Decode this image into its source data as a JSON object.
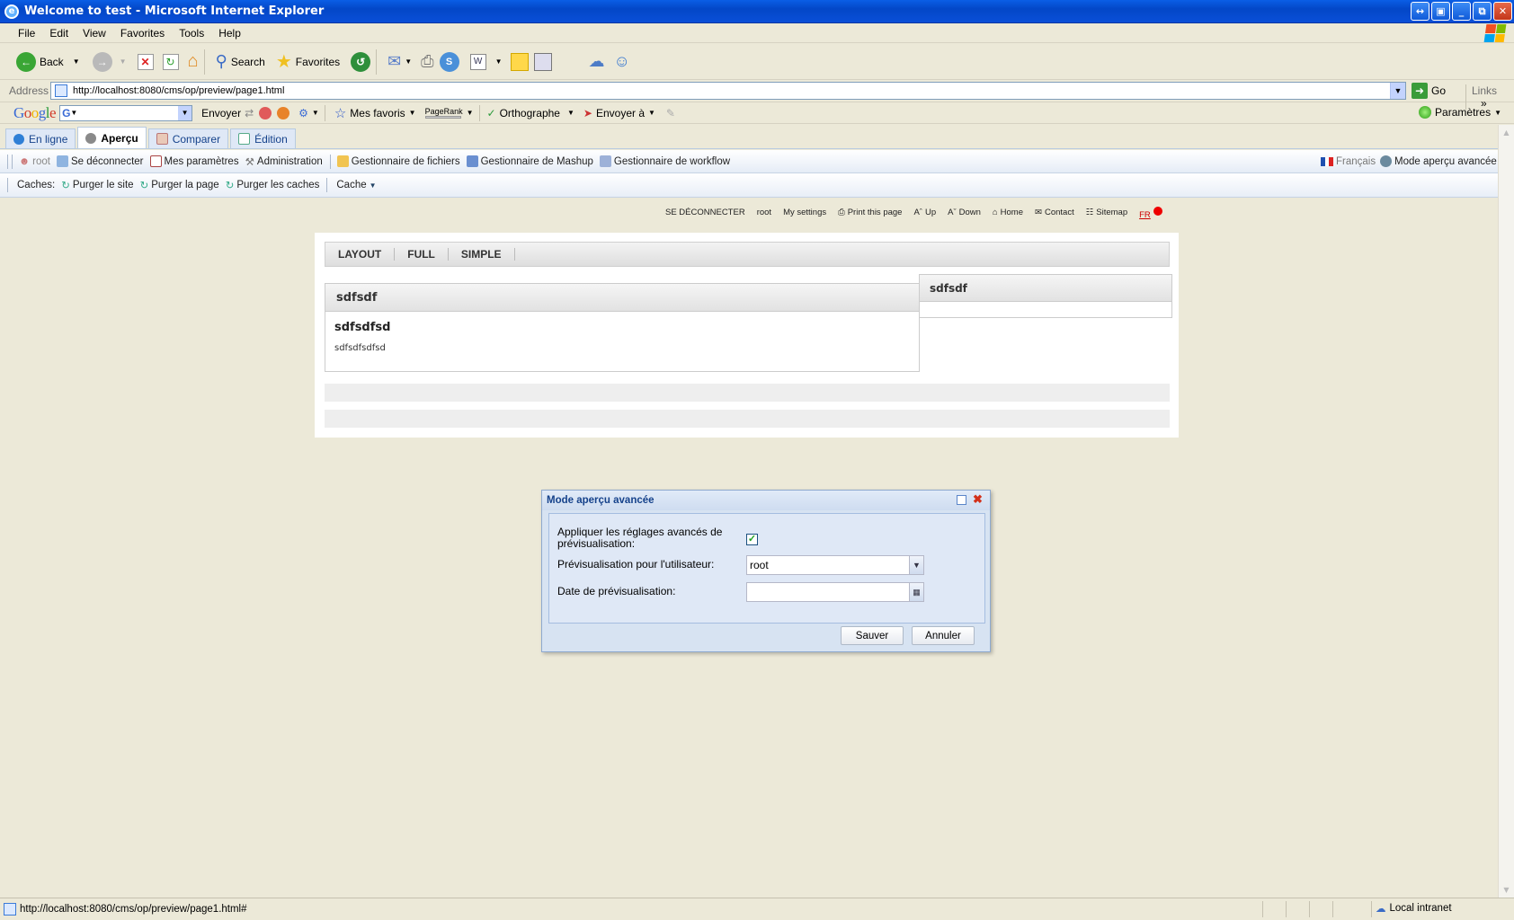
{
  "window": {
    "title": "Welcome to test - Microsoft Internet Explorer"
  },
  "menu": [
    "File",
    "Edit",
    "View",
    "Favorites",
    "Tools",
    "Help"
  ],
  "toolbar": {
    "back": "Back",
    "search": "Search",
    "favorites": "Favorites"
  },
  "address": {
    "label": "Address",
    "url": "http://localhost:8080/cms/op/preview/page1.html",
    "go": "Go",
    "links": "Links"
  },
  "google": {
    "logo": "Google",
    "envoyer": "Envoyer",
    "mes_favoris": "Mes favoris",
    "pagerank": "PageRank",
    "orthographe": "Orthographe",
    "envoyer_a": "Envoyer à",
    "parametres": "Paramètres"
  },
  "mode_tabs": [
    {
      "label": "En ligne"
    },
    {
      "label": "Aperçu"
    },
    {
      "label": "Comparer"
    },
    {
      "label": "Édition"
    }
  ],
  "jahia_bar": {
    "user": "root",
    "logout": "Se déconnecter",
    "settings": "Mes paramètres",
    "admin": "Administration",
    "files": "Gestionnaire de fichiers",
    "mashup": "Gestionnaire de Mashup",
    "workflow": "Gestionnaire de workflow",
    "language": "Français",
    "advanced_preview": "Mode aperçu avancée"
  },
  "cache_bar": {
    "label": "Caches:",
    "purge_site": "Purger le site",
    "purge_page": "Purger la page",
    "purge_caches": "Purger les caches",
    "cache_menu": "Cache"
  },
  "page_links": {
    "logout": "SE DÉCONNECTER",
    "user": "root",
    "settings": "My settings",
    "print": "Print this page",
    "up": "Up",
    "down": "Down",
    "home": "Home",
    "contact": "Contact",
    "sitemap": "Sitemap",
    "lang": "FR"
  },
  "page_nav": [
    "LAYOUT",
    "FULL",
    "SIMPLE"
  ],
  "main_box": {
    "header": "sdfsdf",
    "title": "sdfsdfsd",
    "body": "sdfsdfsdfsd"
  },
  "side_box": {
    "header": "sdfsdf"
  },
  "dialog": {
    "title": "Mode aperçu avancée",
    "apply_label_1": "Appliquer les réglages avancés de",
    "apply_label_2": "prévisualisation:",
    "apply_checked": true,
    "user_label": "Prévisualisation pour l'utilisateur:",
    "user_value": "root",
    "date_label": "Date de prévisualisation:",
    "date_value": "",
    "save": "Sauver",
    "cancel": "Annuler"
  },
  "status": {
    "text": "http://localhost:8080/cms/op/preview/page1.html#",
    "zone": "Local intranet"
  }
}
